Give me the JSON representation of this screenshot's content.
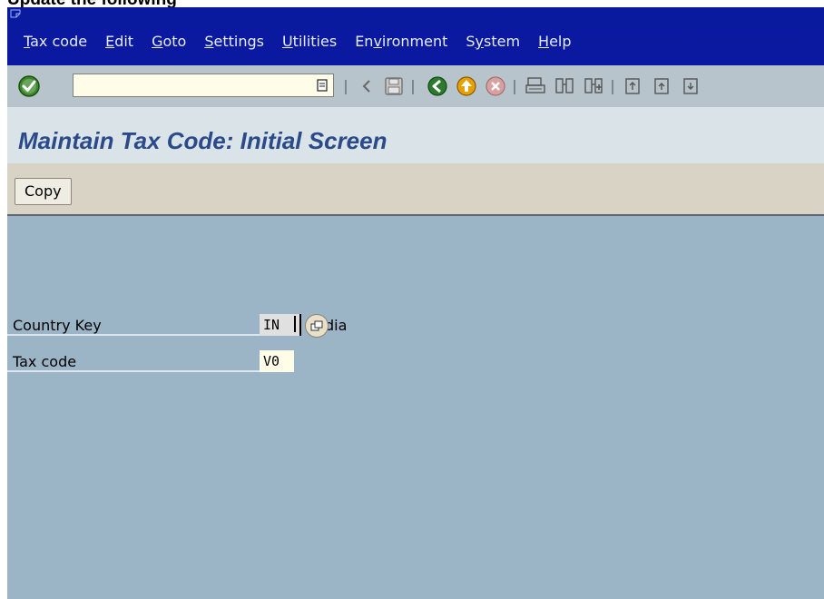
{
  "page_heading": "Update the following",
  "menu": [
    {
      "label": "Tax code",
      "u": "T"
    },
    {
      "label": "Edit",
      "u": "E"
    },
    {
      "label": "Goto",
      "u": "G"
    },
    {
      "label": "Settings",
      "u": "S"
    },
    {
      "label": "Utilities",
      "u": "U"
    },
    {
      "label": "Environment",
      "u": "v"
    },
    {
      "label": "System",
      "u": "y"
    },
    {
      "label": "Help",
      "u": "H"
    }
  ],
  "toolbar": {
    "command_field_value": "",
    "icons": [
      "enter-check-icon",
      "back-arrow-icon",
      "save-icon",
      "back-green-icon",
      "exit-up-icon",
      "cancel-icon",
      "print-icon",
      "find-icon",
      "find-next-icon",
      "first-page-icon",
      "prev-page-icon",
      "next-page-icon"
    ]
  },
  "screen_title": "Maintain Tax Code: Initial Screen",
  "app_toolbar": {
    "copy_label": "Copy"
  },
  "fields": {
    "country_key": {
      "label": "Country Key",
      "value": "IN",
      "description": "dia"
    },
    "tax_code": {
      "label": "Tax code",
      "value": "V0"
    }
  },
  "colors": {
    "menubar": "#0a1a9e",
    "background": "#9bb4c6",
    "title": "#2a4a8a"
  }
}
